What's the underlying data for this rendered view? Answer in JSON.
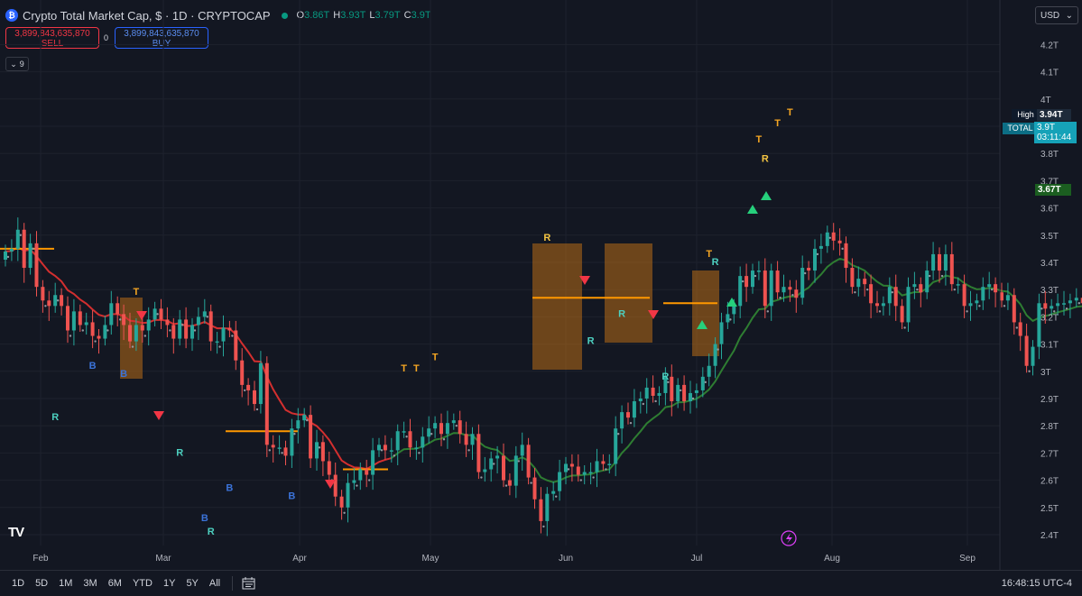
{
  "legend": {
    "symbol_icon": "bitcoin-circle-icon",
    "title": "Crypto Total Market Cap, $ · 1D · CRYPTOCAP",
    "o_key": "O",
    "o_val": "3.86T",
    "h_key": "H",
    "h_val": "3.93T",
    "l_key": "L",
    "l_val": "3.79T",
    "c_key": "C",
    "c_val": "3.9T"
  },
  "trade": {
    "sell_price": "3,899,843,635,870",
    "sell_label": "SELL",
    "spread": "0",
    "buy_price": "3,899,843,635,870",
    "buy_label": "BUY"
  },
  "indicators_count": "9",
  "currency": "USD",
  "chart_data": {
    "type": "candlestick",
    "y_ticks": [
      "4.2T",
      "4.1T",
      "4T",
      "3.9T",
      "3.8T",
      "3.7T",
      "3.6T",
      "3.5T",
      "3.4T",
      "3.3T",
      "3.2T",
      "3.1T",
      "3T",
      "2.9T",
      "2.8T",
      "2.7T",
      "2.6T",
      "2.5T",
      "2.4T"
    ],
    "x_ticks": [
      "Feb",
      "Mar",
      "Apr",
      "May",
      "Jun",
      "Jul",
      "Aug",
      "Sep"
    ],
    "ylim": [
      2.37,
      4.25
    ],
    "close": [
      3.44,
      3.45,
      3.52,
      3.38,
      3.47,
      3.31,
      3.26,
      3.24,
      3.28,
      3.24,
      3.15,
      3.22,
      3.17,
      3.18,
      3.13,
      3.12,
      3.17,
      3.25,
      3.21,
      3.17,
      3.11,
      3.17,
      3.15,
      3.19,
      3.23,
      3.19,
      3.17,
      3.12,
      3.19,
      3.12,
      3.17,
      3.2,
      3.22,
      3.11,
      3.11,
      3.16,
      3.15,
      3.04,
      2.95,
      2.93,
      2.88,
      3.03,
      2.73,
      2.72,
      2.72,
      2.69,
      2.79,
      2.82,
      2.84,
      2.68,
      2.74,
      2.67,
      2.62,
      2.54,
      2.5,
      2.59,
      2.6,
      2.64,
      2.62,
      2.71,
      2.73,
      2.71,
      2.71,
      2.78,
      2.78,
      2.72,
      2.72,
      2.76,
      2.79,
      2.81,
      2.77,
      2.81,
      2.82,
      2.77,
      2.73,
      2.77,
      2.63,
      2.64,
      2.68,
      2.69,
      2.6,
      2.58,
      2.69,
      2.73,
      2.61,
      2.53,
      2.45,
      2.55,
      2.56,
      2.63,
      2.66,
      2.65,
      2.62,
      2.63,
      2.63,
      2.67,
      2.66,
      2.66,
      2.79,
      2.85,
      2.83,
      2.89,
      2.9,
      2.94,
      2.91,
      2.92,
      2.98,
      2.89,
      2.95,
      2.89,
      2.92,
      2.93,
      2.98,
      3.02,
      3.1,
      3.18,
      3.21,
      3.24,
      3.35,
      3.31,
      3.37,
      3.37,
      3.24,
      3.37,
      3.29,
      3.31,
      3.3,
      3.27,
      3.38,
      3.37,
      3.45,
      3.46,
      3.51,
      3.48,
      3.47,
      3.38,
      3.31,
      3.34,
      3.32,
      3.25,
      3.24,
      3.25,
      3.31,
      3.24,
      3.18,
      3.31,
      3.32,
      3.29,
      3.37,
      3.43,
      3.37,
      3.43,
      3.32,
      3.32,
      3.24,
      3.25,
      3.26,
      3.31,
      3.32,
      3.29,
      3.26,
      3.28,
      3.18,
      3.13,
      3.02,
      3.09,
      3.25,
      3.23,
      3.24,
      3.25,
      3.25,
      3.26,
      3.27,
      3.25,
      3.31,
      3.29,
      3.34,
      3.35,
      3.31,
      3.39,
      3.37,
      3.33,
      3.34,
      3.47,
      3.57,
      3.61,
      3.65,
      3.62,
      3.65,
      3.67,
      3.72,
      3.8,
      3.79,
      3.81,
      3.87,
      3.85,
      3.88,
      3.9
    ],
    "labels": [
      {
        "text": "T",
        "kind": "T",
        "i": 21,
        "y": 3.28
      },
      {
        "text": "R",
        "kind": "R",
        "i": 8,
        "y": 2.82
      },
      {
        "text": "B",
        "kind": "B",
        "i": 14,
        "y": 3.01
      },
      {
        "text": "B",
        "kind": "B",
        "i": 19,
        "y": 2.98
      },
      {
        "text": "R",
        "kind": "R",
        "i": 28,
        "y": 2.69
      },
      {
        "text": "B",
        "kind": "B",
        "i": 36,
        "y": 2.56
      },
      {
        "text": "B",
        "kind": "B",
        "i": 32,
        "y": 2.45
      },
      {
        "text": "R",
        "kind": "R",
        "i": 33,
        "y": 2.4
      },
      {
        "text": "B",
        "kind": "B",
        "i": 46,
        "y": 2.53
      },
      {
        "text": "T",
        "kind": "T",
        "i": 64,
        "y": 3.0
      },
      {
        "text": "T",
        "kind": "T",
        "i": 66,
        "y": 3.0
      },
      {
        "text": "T",
        "kind": "T",
        "i": 69,
        "y": 3.04
      },
      {
        "text": "R",
        "kind": "R",
        "i": 87,
        "y": 3.48
      },
      {
        "text": "R",
        "kind": "R",
        "i": 94,
        "y": 3.1
      },
      {
        "text": "R",
        "kind": "R",
        "i": 99,
        "y": 3.2
      },
      {
        "text": "R",
        "kind": "R",
        "i": 106,
        "y": 2.97
      },
      {
        "text": "T",
        "kind": "T",
        "i": 113,
        "y": 3.42
      },
      {
        "text": "R",
        "kind": "R",
        "i": 114,
        "y": 3.39
      },
      {
        "text": "T",
        "kind": "T",
        "i": 121,
        "y": 3.84
      },
      {
        "text": "R",
        "kind": "R",
        "i": 122,
        "y": 3.77
      },
      {
        "text": "T",
        "kind": "T",
        "i": 124,
        "y": 3.9
      },
      {
        "text": "T",
        "kind": "T",
        "i": 126,
        "y": 3.94
      }
    ]
  },
  "price_tags": {
    "high_label": "High",
    "high_value": "3.94T",
    "symbol": "TOTAL",
    "last_value": "3.9T",
    "countdown": "03:11:44",
    "ma_value": "3.67T"
  },
  "colors": {
    "up": "#26a69a",
    "down": "#ef5350",
    "accent": "#2962ff",
    "ma_down": "#d32f2f",
    "ma_up": "#2e7d32",
    "zone": "#b86b16"
  },
  "ranges": [
    "1D",
    "5D",
    "1M",
    "3M",
    "6M",
    "YTD",
    "1Y",
    "5Y",
    "All"
  ],
  "calendar_icon": "calendar-icon",
  "clock": "16:48:15 UTC-4",
  "tv_logo": "TV"
}
